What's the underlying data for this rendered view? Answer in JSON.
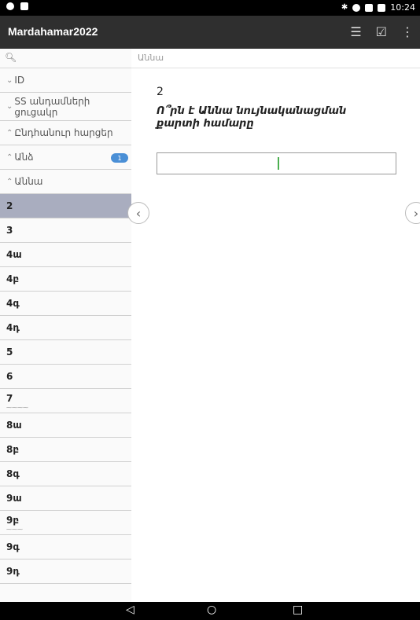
{
  "status_bar": {
    "time": "10:24"
  },
  "app_bar": {
    "title": "Mardahamar2022",
    "actions": [
      "list-icon",
      "edit-icon",
      "more-vert-icon"
    ]
  },
  "sidebar": {
    "search_icon": "search-icon",
    "items": [
      {
        "label": "ID",
        "type": "group",
        "chevron": "down"
      },
      {
        "label": "SS անդամների ցուցակր",
        "type": "group",
        "chevron": "down"
      },
      {
        "label": "Ընդհանուր հարցեր",
        "type": "group",
        "chevron": "up"
      },
      {
        "label": "Անձ",
        "type": "group",
        "chevron": "up",
        "badge": "1"
      },
      {
        "label": "Աննա",
        "type": "group",
        "chevron": "up"
      },
      {
        "label": "2",
        "selected": true
      },
      {
        "label": "3"
      },
      {
        "label": "4ա"
      },
      {
        "label": "4բ"
      },
      {
        "label": "4գ"
      },
      {
        "label": "4դ"
      },
      {
        "label": "5"
      },
      {
        "label": "6"
      },
      {
        "label": "7"
      },
      {
        "label": "8ա"
      },
      {
        "label": "8բ"
      },
      {
        "label": "8գ"
      },
      {
        "label": "9ա"
      },
      {
        "label": "9բ"
      },
      {
        "label": "9գ"
      },
      {
        "label": "9դ"
      }
    ]
  },
  "main": {
    "breadcrumb": "Աննա",
    "question_number": "2",
    "question_text": "Ո՞րն է Աննա նույնականացման քարտի համարը",
    "answer_value": ""
  },
  "nav_bar": {
    "back": "◁",
    "home": "○",
    "recents": "□"
  }
}
